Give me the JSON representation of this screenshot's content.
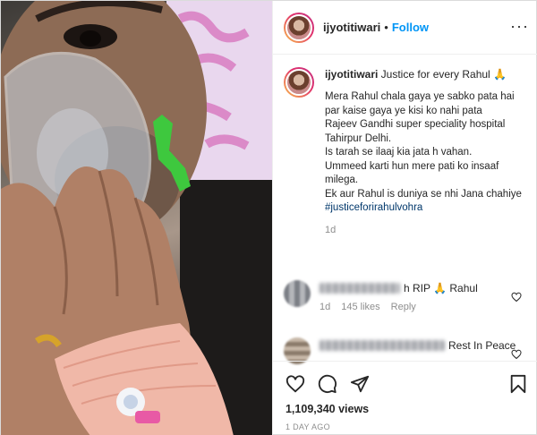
{
  "header": {
    "username": "ijyotitiwari",
    "separator": "•",
    "follow_label": "Follow",
    "more_label": "···"
  },
  "caption": {
    "username": "ijyotitiwari",
    "title": "Justice for every Rahul 🙏",
    "body": "Mera Rahul chala gaya ye sabko pata hai par kaise gaya ye kisi ko nahi pata\nRajeev Gandhi super speciality hospital Tahirpur Delhi.\nIs tarah se ilaaj kia jata h vahan.\nUmmeed karti hun mere pati ko insaaf milega.\nEk aur Rahul is duniya se nhi Jana chahiye",
    "hashtag": "#justiceforirahulvohra",
    "time": "1d"
  },
  "comments": [
    {
      "text": "h RIP 🙏 Rahul",
      "time": "1d",
      "likes": "145 likes",
      "reply": "Reply"
    },
    {
      "text": "Rest In Peace",
      "time": "",
      "likes": "",
      "reply": ""
    }
  ],
  "actions": {
    "views": "1,109,340 views",
    "age": "1 DAY AGO"
  },
  "icons": [
    "heart-icon",
    "comment-icon",
    "share-icon",
    "bookmark-icon",
    "more-icon"
  ]
}
